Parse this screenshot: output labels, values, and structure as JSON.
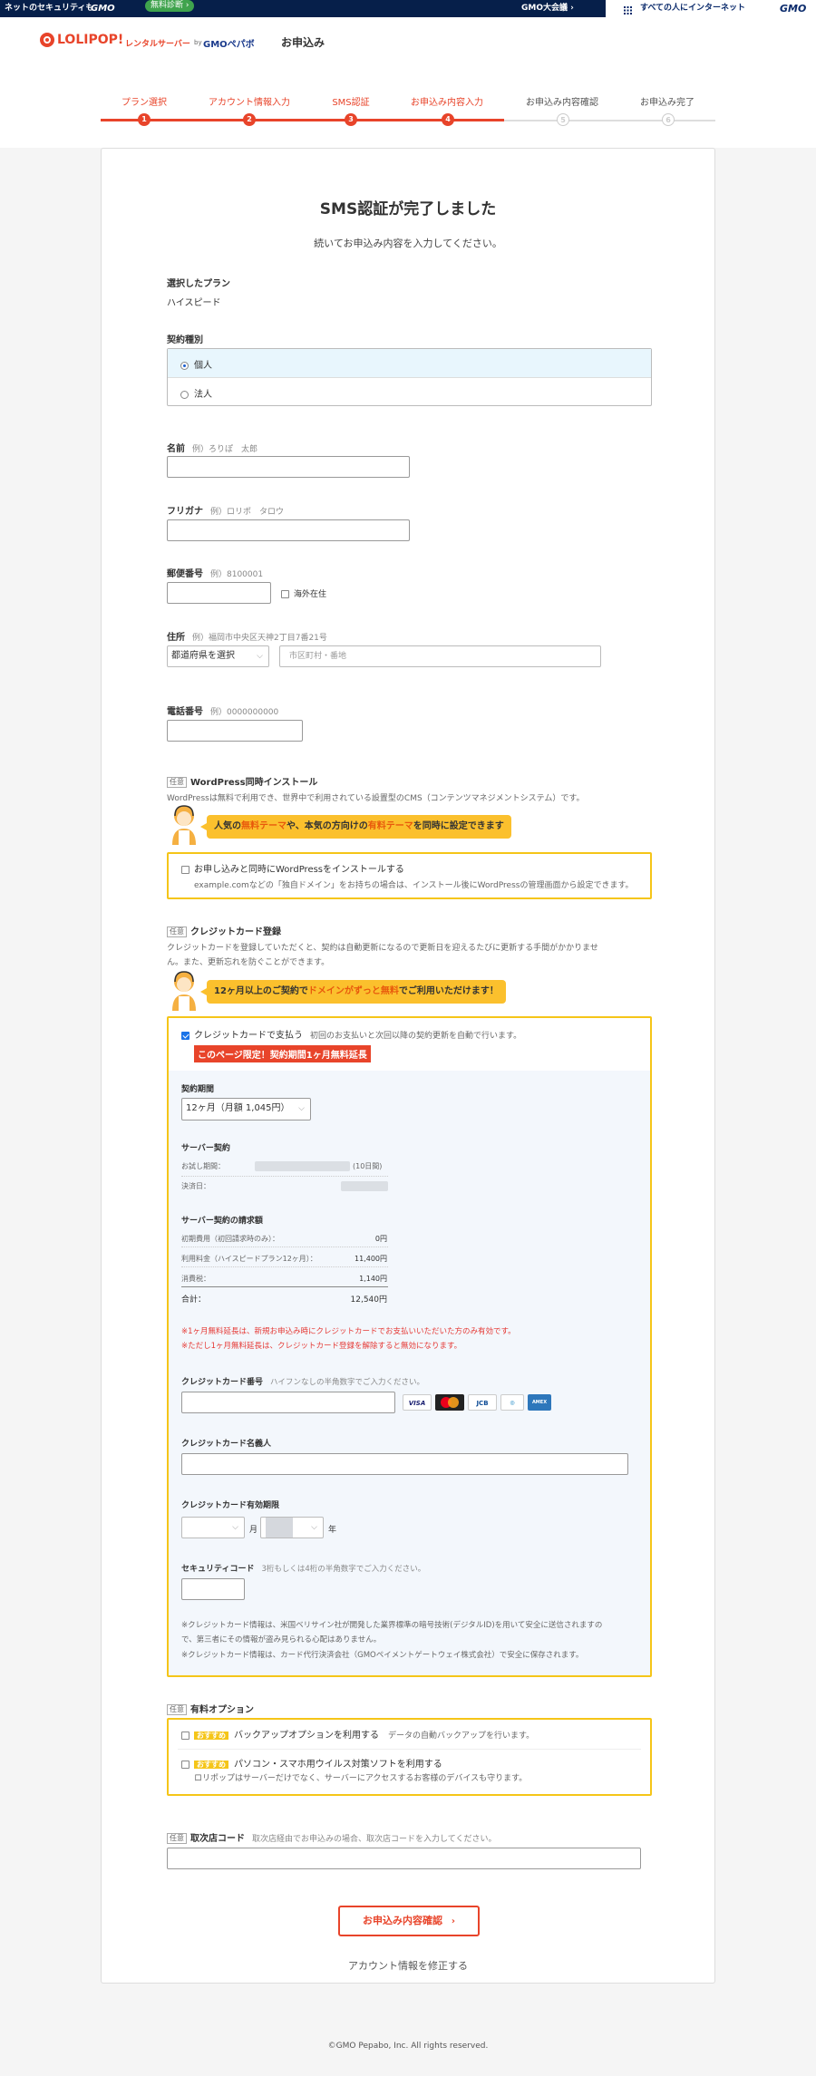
{
  "topbar": {
    "left_text": "ネットのセキュリティも",
    "gmo": "GMO",
    "diag_pill": "無料診断",
    "taikai": "GMO大会議",
    "right_text": "すべての人にインターネット",
    "right_gmo": "GMO"
  },
  "header": {
    "logo": "LOLIPOP!",
    "logo_sub": "レンタルサーバー",
    "by": "by",
    "gmo_pepabo": "GMOペパボ",
    "page_title": "お申込み"
  },
  "steps": [
    {
      "label": "プラン選択",
      "num": "1"
    },
    {
      "label": "アカウント情報入力",
      "num": "2"
    },
    {
      "label": "SMS認証",
      "num": "3"
    },
    {
      "label": "お申込み内容入力",
      "num": "4"
    },
    {
      "label": "お申込み内容確認",
      "num": "5"
    },
    {
      "label": "お申込み完了",
      "num": "6"
    }
  ],
  "colors": {
    "accent": "#e8442a",
    "yellow": "#f5c518",
    "blue_panel": "#f3f7fc"
  },
  "main": {
    "title": "SMS認証が完了しました",
    "subtitle": "続いてお申込み内容を入力してください。",
    "plan_label": "選択したプラン",
    "plan_value": "ハイスピード",
    "contract_type_label": "契約種別",
    "contract_options": [
      "個人",
      "法人"
    ],
    "name_label": "名前",
    "name_ex": "例）ろりぽ　太郎",
    "furigana_label": "フリガナ",
    "furigana_ex": "例）ロリポ　タロウ",
    "postal_label": "郵便番号",
    "postal_ex": "例）8100001",
    "overseas": "海外在住",
    "address_label": "住所",
    "address_ex": "例）福岡市中央区天神2丁目7番21号",
    "pref_select": "都道府県を選択",
    "city_placeholder": "市区町村・番地",
    "phone_label": "電話番号",
    "phone_ex": "例）0000000000",
    "optional": "任意",
    "wp_title": "WordPress同時インストール",
    "wp_desc": "WordPressは無料で利用でき、世界中で利用されている設置型のCMS（コンテンツマネジメントシステム）です。",
    "wp_promo_a": "人気の",
    "wp_promo_b": "無料テーマ",
    "wp_promo_c": "や、本気の方向けの",
    "wp_promo_d": "有料テーマ",
    "wp_promo_e": "を同時に設定できます",
    "wp_check": "お申し込みと同時にWordPressをインストールする",
    "wp_note": "example.comなどの「独自ドメイン」をお持ちの場合は、インストール後にWordPressの管理画面から設定できます。",
    "cc_title": "クレジットカード登録",
    "cc_desc1": "クレジットカードを登録していただくと、契約は自動更新になるので更新日を迎えるたびに更新する手間がかかりませ",
    "cc_desc2": "ん。また、更新忘れを防ぐことができます。",
    "cc_promo_a": "12ヶ月以上のご契約で",
    "cc_promo_b": "ドメインがずっと無料",
    "cc_promo_c": "でご利用いただけます！",
    "cc_check": "クレジットカードで支払う",
    "cc_check_note": "初回のお支払いと次回以降の契約更新を自動で行います。",
    "cc_ribbon": "このページ限定！契約期間1ヶ月無料延長",
    "period_label": "契約期間",
    "period_value": "12ヶ月（月額 1,045円）",
    "server_label": "サーバー契約",
    "trial_label": "お試し期間：",
    "trial_days": "(10日間)",
    "settle_label": "決済日：",
    "bill_label": "サーバー契約の請求額",
    "bill_rows": [
      {
        "k": "初期費用（初回請求時のみ）：",
        "v": "0円"
      },
      {
        "k": "利用料金（ハイスピードプラン12ヶ月）：",
        "v": "11,400円"
      },
      {
        "k": "消費税：",
        "v": "1,140円"
      }
    ],
    "total_label": "合計：",
    "total_value": "12,540円",
    "note_red1": "※1ヶ月無料延長は、新規お申込み時にクレジットカードでお支払いいただいた方のみ有効です。",
    "note_red2": "※ただし1ヶ月無料延長は、クレジットカード登録を解除すると無効になります。",
    "cc_number_label": "クレジットカード番号",
    "cc_number_help": "ハイフンなしの半角数字でご入力ください。",
    "cc_name_label": "クレジットカード名義人",
    "cc_exp_label": "クレジットカード有効期限",
    "month": "月",
    "year": "年",
    "sec_label": "セキュリティコード",
    "sec_help": "3桁もしくは4桁の半角数字でご入力ください。",
    "cc_note1": "※クレジットカード情報は、米国ベリサイン社が開発した業界標準の暗号技術(デジタルID)を用いて安全に送信されますの",
    "cc_note2": "で、第三者にその情報が盗み見られる心配はありません。",
    "cc_note3": "※クレジットカード情報は、カード代行決済会社（GMOペイメントゲートウェイ株式会社）で安全に保存されます。",
    "cards": [
      "VISA",
      "MC",
      "JCB",
      "DINERS",
      "AMEX"
    ],
    "paid_title": "有料オプション",
    "recommend": "おすすめ",
    "backup": "バックアップオプションを利用する",
    "backup_note": "データの自動バックアップを行います。",
    "virus": "パソコン・スマホ用ウイルス対策ソフトを利用する",
    "virus_note": "ロリポップはサーバーだけでなく、サーバーにアクセスするお客様のデバイスも守ります。",
    "agency_label": "取次店コード",
    "agency_help": "取次店経由でお申込みの場合、取次店コードを入力してください。",
    "confirm_btn": "お申込み内容確認",
    "edit_link": "アカウント情報を修正する"
  },
  "footer": {
    "copyright": "©GMO Pepabo, Inc. All rights reserved."
  }
}
